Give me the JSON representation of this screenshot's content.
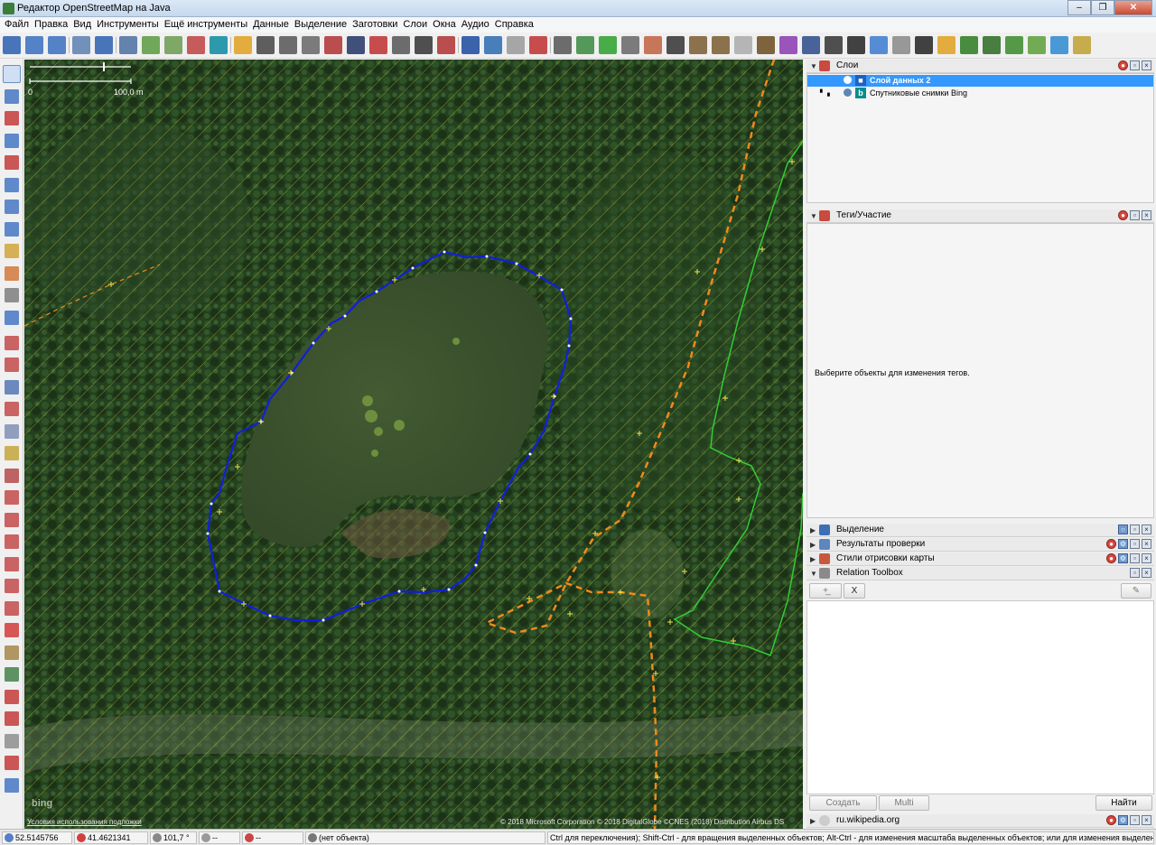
{
  "window": {
    "title": "Редактор OpenStreetMap на Java",
    "controls": {
      "minimize": "‒",
      "maximize": "❐",
      "close": "✕"
    }
  },
  "menu": [
    "Файл",
    "Правка",
    "Вид",
    "Инструменты",
    "Ещё инструменты",
    "Данные",
    "Выделение",
    "Заготовки",
    "Слои",
    "Окна",
    "Аудио",
    "Справка"
  ],
  "toolbar": {
    "icons": [
      "open-file-icon",
      "download-icon",
      "upload-icon",
      "undo-icon",
      "redo-icon",
      "preferences-icon",
      "wms-icon",
      "layer-icon",
      "recycle-icon",
      "bing-icon",
      "road-icon",
      "road-icon",
      "building-icon",
      "barrier-icon",
      "wall-icon",
      "railway-icon",
      "bridge-icon",
      "hatch-icon",
      "car-icon",
      "car-icon",
      "info-icon",
      "globe-icon",
      "circle-icon",
      "flag-icon",
      "theatre-icon",
      "board-icon",
      "health-icon",
      "bowl-icon",
      "flowers-icon",
      "phone-icon",
      "castle-icon",
      "factory-icon",
      "house-icon",
      "fork-icon",
      "cart-icon",
      "shirt-icon",
      "box-icon",
      "dollar-icon",
      "sign-icon",
      "clip-icon",
      "person-icon",
      "bag-icon",
      "tree-icon",
      "forest-icon",
      "plant-icon",
      "grass-icon",
      "water-icon",
      "wheat-icon"
    ]
  },
  "map": {
    "scale_zero": "0",
    "scale_label": "100,0 m",
    "terms_link": "Условия использования подложки",
    "bing_logo": "bing",
    "attribution": "© 2018 Microsoft Corporation © 2018 DigitalGlobe ©CNES (2018) Distribution Airbus DS"
  },
  "layers_panel": {
    "title": "Слои",
    "layers": [
      {
        "name": "Слой данных 2",
        "selected": true
      },
      {
        "name": "Спутниковые снимки Bing",
        "selected": false
      }
    ]
  },
  "tags_panel": {
    "title": "Теги/Участие",
    "empty_message": "Выберите объекты для изменения тегов."
  },
  "collapsed_panels": [
    "Выделение",
    "Результаты проверки",
    "Стили отрисовки карты"
  ],
  "relation_toolbox": {
    "title": "Relation Toolbox",
    "add_button": "+̲",
    "remove_button": "X",
    "edit_button": "✎",
    "create_button": "Создать",
    "multi_button": "Multi",
    "find_button": "Найти"
  },
  "wikipedia_panel": {
    "title": "ru.wikipedia.org"
  },
  "status": {
    "lat": "52.5145756",
    "lon": "41.4621341",
    "heading": "101,7 °",
    "angle": "--",
    "distance": "--",
    "object": "(нет объекта)",
    "hint": "Ctrl для переключения); Shift-Ctrl - для вращения выделенных объектов; Alt-Ctrl - для изменения масштаба выделенных объектов; или для изменения выделения"
  },
  "colors": {
    "selected": "#3399ff",
    "lake_outline": "#1020d8",
    "path_dashed": "#f08a1a",
    "forest_outline": "#33cc33",
    "hatch": "#d6d636"
  }
}
